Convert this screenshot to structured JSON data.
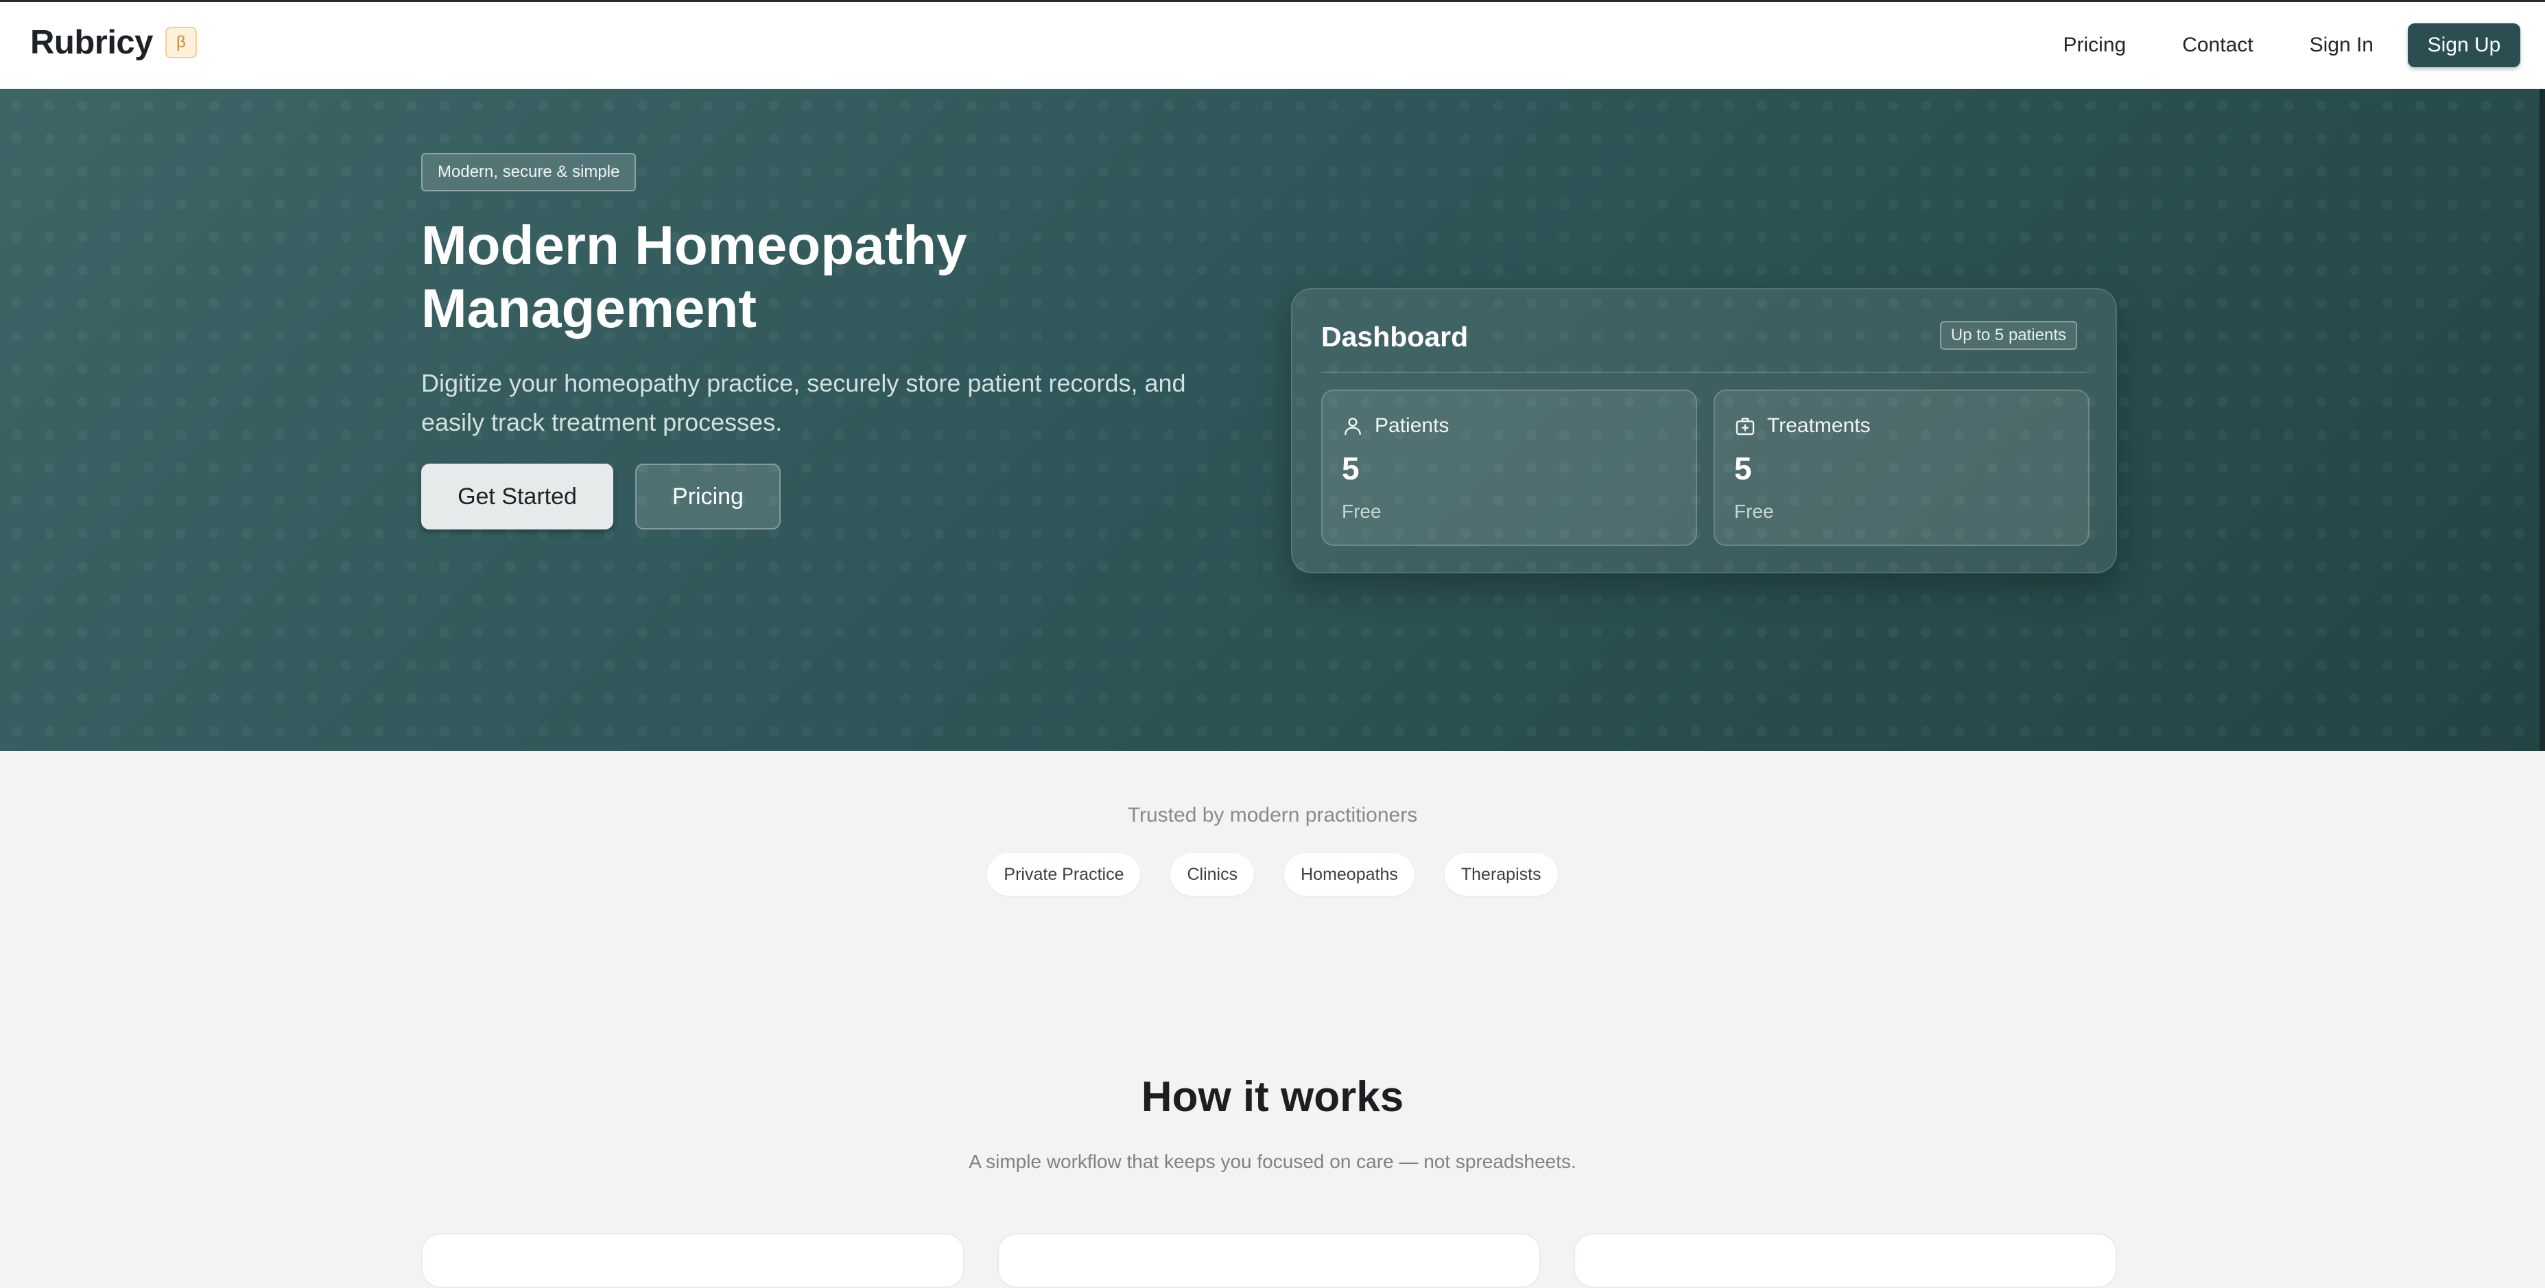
{
  "nav": {
    "brand": "Rubricy",
    "beta": "β",
    "links": [
      "Pricing",
      "Contact",
      "Sign In"
    ],
    "signup": "Sign Up"
  },
  "hero": {
    "badge": "Modern, secure & simple",
    "title": "Modern Homeopathy Management",
    "subtitle": "Digitize your homeopathy practice, securely store patient records, and easily track treatment processes.",
    "primary_cta": "Get Started",
    "secondary_cta": "Pricing"
  },
  "dashboard": {
    "title": "Dashboard",
    "pill": "Up to 5 patients",
    "cards": [
      {
        "label": "Patients",
        "value": "5",
        "foot": "Free",
        "icon": "user-icon"
      },
      {
        "label": "Treatments",
        "value": "5",
        "foot": "Free",
        "icon": "medical-bag-icon"
      }
    ]
  },
  "trusted": {
    "caption": "Trusted by modern practitioners",
    "chips": [
      "Private Practice",
      "Clinics",
      "Homeopaths",
      "Therapists"
    ]
  },
  "how": {
    "title": "How it works",
    "subtitle": "A simple workflow that keeps you focused on care — not spreadsheets."
  },
  "colors": {
    "accent": "#2b4f51",
    "hero_start": "#3e6566",
    "hero_end": "#234445",
    "background": "#f4f3f1",
    "beta_bg": "#fdf1dc"
  }
}
